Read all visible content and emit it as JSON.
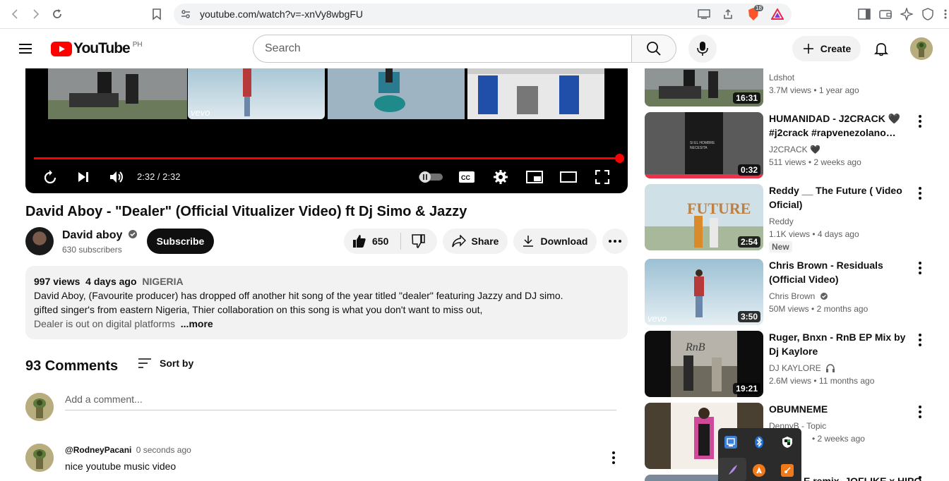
{
  "browser": {
    "url": "youtube.com/watch?v=-xnVy8wbgFU",
    "brave_badge": "18"
  },
  "header": {
    "logo_text": "YouTube",
    "country": "PH",
    "search_placeholder": "Search",
    "create_label": "Create"
  },
  "player": {
    "time": "2:32 / 2:32",
    "progress": 1.0
  },
  "video": {
    "title": "David Aboy - \"Dealer\" (Official Vitualizer Video) ft Dj Simo & Jazzy",
    "channel": "David aboy",
    "subscribers": "630 subscribers",
    "subscribe_label": "Subscribe",
    "likes": "650",
    "share_label": "Share",
    "download_label": "Download"
  },
  "description": {
    "views": "997 views",
    "age": "4 days ago",
    "tag": "NIGERIA",
    "line1": "David Aboy, (Favourite producer) has dropped off another hit song of the year titled \"dealer\" featuring Jazzy and DJ simo.",
    "line2": "gifted singer's from eastern Nigeria, Thier collaboration on this song is what you don't want to miss out,",
    "line3": "Dealer is out on digital platforms",
    "more": "...more"
  },
  "comments": {
    "count": "93 Comments",
    "sort_label": "Sort by",
    "add_placeholder": "Add a comment...",
    "items": [
      {
        "author": "@RodneyPacani",
        "time": "0 seconds ago",
        "text": "nice youtube music video"
      }
    ]
  },
  "sidebar": {
    "items": [
      {
        "title": "",
        "channel": "Ldshot",
        "views": "3.7M views",
        "age": "1 year ago",
        "duration": "16:31"
      },
      {
        "title": "HUMANIDAD - J2CRACK 🖤 #j2crack #rapvenezolano…",
        "channel": "J2CRACK 🖤",
        "views": "511 views",
        "age": "2 weeks ago",
        "duration": "0:32"
      },
      {
        "title": "Reddy __ The Future ( Video Oficial)",
        "channel": "Reddy",
        "views": "1.1K views",
        "age": "4 days ago",
        "duration": "2:54",
        "badge": "New"
      },
      {
        "title": "Chris Brown - Residuals (Official Video)",
        "channel": "Chris Brown",
        "views": "50M views",
        "age": "2 months ago",
        "duration": "3:50"
      },
      {
        "title": "Ruger, Bnxn - RnB EP Mix by Dj Kaylore",
        "channel": "DJ KAYLORE",
        "views": "2.6M views",
        "age": "11 months ago",
        "duration": "19:21"
      },
      {
        "title": "OBUMNEME",
        "channel": "DennyB - Topic",
        "views": "",
        "age": "2 weeks ago",
        "duration": ""
      },
      {
        "title": "E remix, JOFLIKE x HIPO",
        "channel": "",
        "views": "",
        "age": "",
        "duration": ""
      }
    ]
  },
  "colors": {
    "accent": "#ff0000",
    "text": "#0f0f0f",
    "muted": "#606060",
    "chip": "#f2f2f2"
  }
}
